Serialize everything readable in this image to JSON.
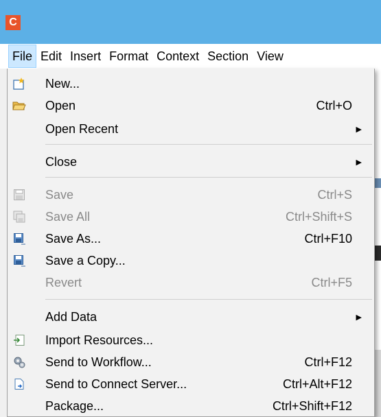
{
  "app": {
    "icon_letter": "C",
    "accent": "#e8542b",
    "titlebar_color": "#5cb0e6"
  },
  "menubar": {
    "items": [
      "File",
      "Edit",
      "Insert",
      "Format",
      "Context",
      "Section",
      "View"
    ]
  },
  "file_menu": {
    "items": [
      {
        "label": "New...",
        "shortcut": "",
        "icon": "new-document-icon",
        "enabled": true,
        "submenu": false
      },
      {
        "label": "Open",
        "shortcut": "Ctrl+O",
        "icon": "open-folder-icon",
        "enabled": true,
        "submenu": false
      },
      {
        "label": "Open Recent",
        "shortcut": "",
        "icon": "",
        "enabled": true,
        "submenu": true
      },
      {
        "label": "Close",
        "shortcut": "",
        "icon": "",
        "enabled": true,
        "submenu": true
      },
      {
        "label": "Save",
        "shortcut": "Ctrl+S",
        "icon": "save-icon",
        "enabled": false,
        "submenu": false
      },
      {
        "label": "Save All",
        "shortcut": "Ctrl+Shift+S",
        "icon": "save-all-icon",
        "enabled": false,
        "submenu": false
      },
      {
        "label": "Save As...",
        "shortcut": "Ctrl+F10",
        "icon": "save-as-icon",
        "enabled": true,
        "submenu": false
      },
      {
        "label": "Save a Copy...",
        "shortcut": "",
        "icon": "save-copy-icon",
        "enabled": true,
        "submenu": false
      },
      {
        "label": "Revert",
        "shortcut": "Ctrl+F5",
        "icon": "",
        "enabled": false,
        "submenu": false
      },
      {
        "label": "Add Data",
        "shortcut": "",
        "icon": "",
        "enabled": true,
        "submenu": true
      },
      {
        "label": "Import Resources...",
        "shortcut": "",
        "icon": "import-icon",
        "enabled": true,
        "submenu": false
      },
      {
        "label": "Send to Workflow...",
        "shortcut": "Ctrl+F12",
        "icon": "workflow-gear-icon",
        "enabled": true,
        "submenu": false
      },
      {
        "label": "Send to Connect Server...",
        "shortcut": "Ctrl+Alt+F12",
        "icon": "connect-server-icon",
        "enabled": true,
        "submenu": false
      },
      {
        "label": "Package...",
        "shortcut": "Ctrl+Shift+F12",
        "icon": "",
        "enabled": true,
        "submenu": false
      }
    ]
  }
}
